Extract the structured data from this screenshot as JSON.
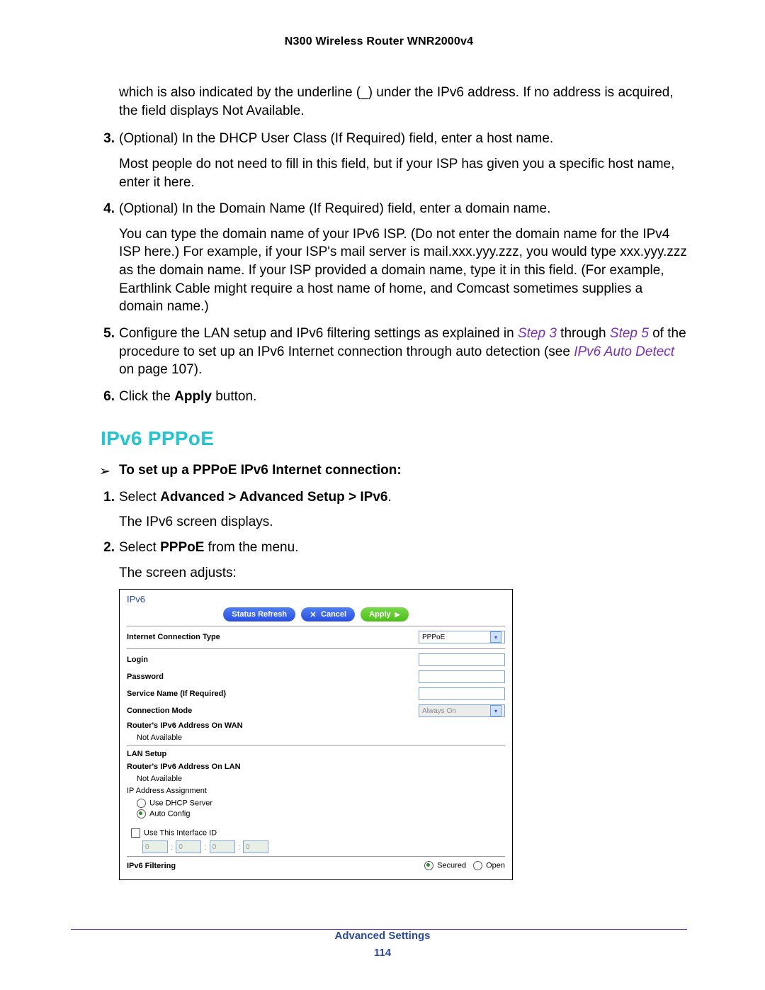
{
  "header": "N300 Wireless Router WNR2000v4",
  "cont_para": "which is also indicated by the underline (_) under the IPv6 address. If no address is acquired, the field displays Not Available.",
  "items": {
    "i3_lead": "(Optional) In the DHCP User Class (If Required) field, enter a host name.",
    "i3_body": "Most people do not need to fill in this field, but if your ISP has given you a specific host name, enter it here.",
    "i4_lead": "(Optional) In the Domain Name (If Required) field, enter a domain name.",
    "i4_body": "You can type the domain name of your IPv6 ISP. (Do not enter the domain name for the IPv4 ISP here.) For example, if your ISP's mail server is mail.xxx.yyy.zzz, you would type xxx.yyy.zzz as the domain name. If your ISP provided a domain name, type it in this field. (For example, Earthlink Cable might require a host name of home, and Comcast sometimes supplies a domain name.)",
    "i5_pre": "Configure the LAN setup and IPv6 filtering settings as explained in ",
    "i5_step3": "Step 3",
    "i5_mid1": " through ",
    "i5_step5": "Step 5",
    "i5_mid2": " of the procedure to set up an IPv6 Internet connection through auto detection (see ",
    "i5_link": "IPv6 Auto Detect",
    "i5_post": " on page 107).",
    "i6_pre": "Click the ",
    "i6_bold": "Apply",
    "i6_post": " button."
  },
  "section_heading": "IPv6 PPPoE",
  "proc_title": "To set up a PPPoE IPv6 Internet connection:",
  "sub": {
    "s1_pre": "Select ",
    "s1_bold": "Advanced > Advanced Setup > IPv6",
    "s1_post": ".",
    "s1_body": "The IPv6 screen displays.",
    "s2_pre": "Select ",
    "s2_bold": "PPPoE",
    "s2_post": " from the menu.",
    "s2_body": "The screen adjusts:"
  },
  "screenshot": {
    "title": "IPv6",
    "btn_status": "Status Refresh",
    "btn_cancel": "Cancel",
    "btn_apply": "Apply",
    "row_conntype": "Internet Connection Type",
    "val_conntype": "PPPoE",
    "row_login": "Login",
    "row_password": "Password",
    "row_service": "Service Name (If Required)",
    "row_connmode": "Connection Mode",
    "val_connmode": "Always On",
    "row_wanaddr": "Router's IPv6 Address On WAN",
    "val_wanaddr": "Not Available",
    "row_lansetup": "LAN Setup",
    "row_lanaddr": "Router's IPv6 Address On LAN",
    "val_lanaddr": "Not Available",
    "row_ipassign": "IP Address Assignment",
    "opt_dhcp": "Use DHCP Server",
    "opt_auto": "Auto Config",
    "chk_iid": "Use This Interface ID",
    "iid_val": "0",
    "row_filter": "IPv6 Filtering",
    "opt_secured": "Secured",
    "opt_open": "Open"
  },
  "footer_section": "Advanced Settings",
  "footer_page": "114"
}
